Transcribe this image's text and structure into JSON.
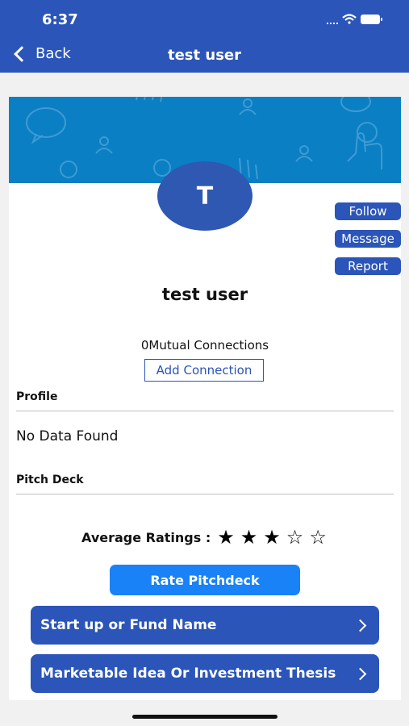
{
  "status_bar": {
    "time": "6:37"
  },
  "nav": {
    "back_label": "Back",
    "title": "test user"
  },
  "profile": {
    "avatar_initial": "T",
    "name": "test user",
    "actions": {
      "follow": "Follow",
      "message": "Message",
      "report": "Report"
    },
    "mutual_connections": "0Mutual Connections",
    "add_connection": "Add Connection"
  },
  "sections": {
    "profile_label": "Profile",
    "profile_empty": "No Data Found",
    "pitch_deck_label": "Pitch Deck"
  },
  "ratings": {
    "label": "Average Ratings :",
    "value": 3,
    "max": 5,
    "filled_star": "★",
    "empty_star": "☆"
  },
  "rate_button": "Rate Pitchdeck",
  "list_rows": [
    "Start up or Fund Name",
    "Marketable Idea Or Investment Thesis"
  ],
  "colors": {
    "nav_blue": "#2b55b8",
    "banner_blue": "#0a7fc4",
    "rate_button": "#1a82f7"
  }
}
